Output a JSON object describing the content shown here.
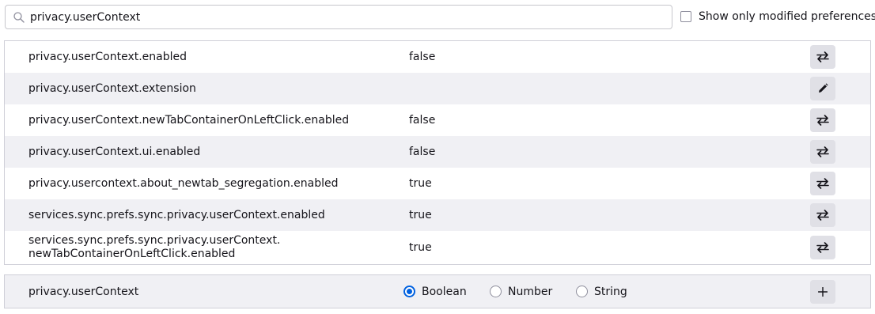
{
  "search": {
    "value": "privacy.userContext",
    "icon": "search-icon"
  },
  "show_modified": {
    "label": "Show only modified preferences",
    "checked": false
  },
  "prefs": [
    {
      "name": "privacy.userContext.enabled",
      "value": "false",
      "action": "toggle-icon"
    },
    {
      "name": "privacy.userContext.extension",
      "value": "",
      "action": "edit-icon"
    },
    {
      "name": "privacy.userContext.newTabContainerOnLeftClick.enabled",
      "value": "false",
      "action": "toggle-icon"
    },
    {
      "name": "privacy.userContext.ui.enabled",
      "value": "false",
      "action": "toggle-icon"
    },
    {
      "name": "privacy.usercontext.about_newtab_segregation.enabled",
      "value": "true",
      "action": "toggle-icon"
    },
    {
      "name": "services.sync.prefs.sync.privacy.userContext.enabled",
      "value": "true",
      "action": "toggle-icon"
    },
    {
      "name": "services.sync.prefs.sync.privacy.userContext.",
      "name_line2": "newTabContainerOnLeftClick.enabled",
      "value": "true",
      "action": "toggle-icon"
    }
  ],
  "add_row": {
    "name": "privacy.userContext",
    "types": [
      {
        "label": "Boolean",
        "checked": true
      },
      {
        "label": "Number",
        "checked": false
      },
      {
        "label": "String",
        "checked": false
      }
    ],
    "action": "plus-icon"
  },
  "colors": {
    "accent": "#0061e0",
    "row_alt": "#f0f0f4",
    "button_bg": "#e0e0e6"
  }
}
